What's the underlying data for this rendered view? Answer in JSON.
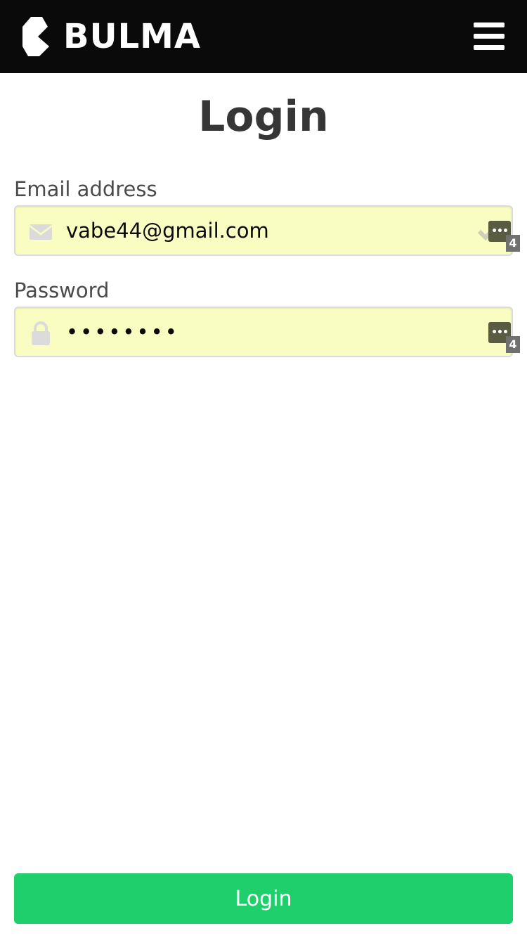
{
  "navbar": {
    "brand": "BULMA",
    "brand_logo_icon": "bulma-logo-icon",
    "menu_icon": "hamburger-menu-icon",
    "background": "#0a0a0a"
  },
  "page": {
    "title": "Login"
  },
  "form": {
    "email": {
      "label": "Email address",
      "value": "vabe44@gmail.com",
      "left_icon": "envelope-icon",
      "right_icon": "check-icon",
      "password_manager_badge": "•••",
      "password_manager_count": "4"
    },
    "password": {
      "label": "Password",
      "value": "••••••••",
      "left_icon": "lock-icon",
      "password_manager_badge": "•••",
      "password_manager_count": "4"
    },
    "autofill_color": "#fafdc1"
  },
  "actions": {
    "login_label": "Login",
    "login_color": "#1fcf6c"
  }
}
